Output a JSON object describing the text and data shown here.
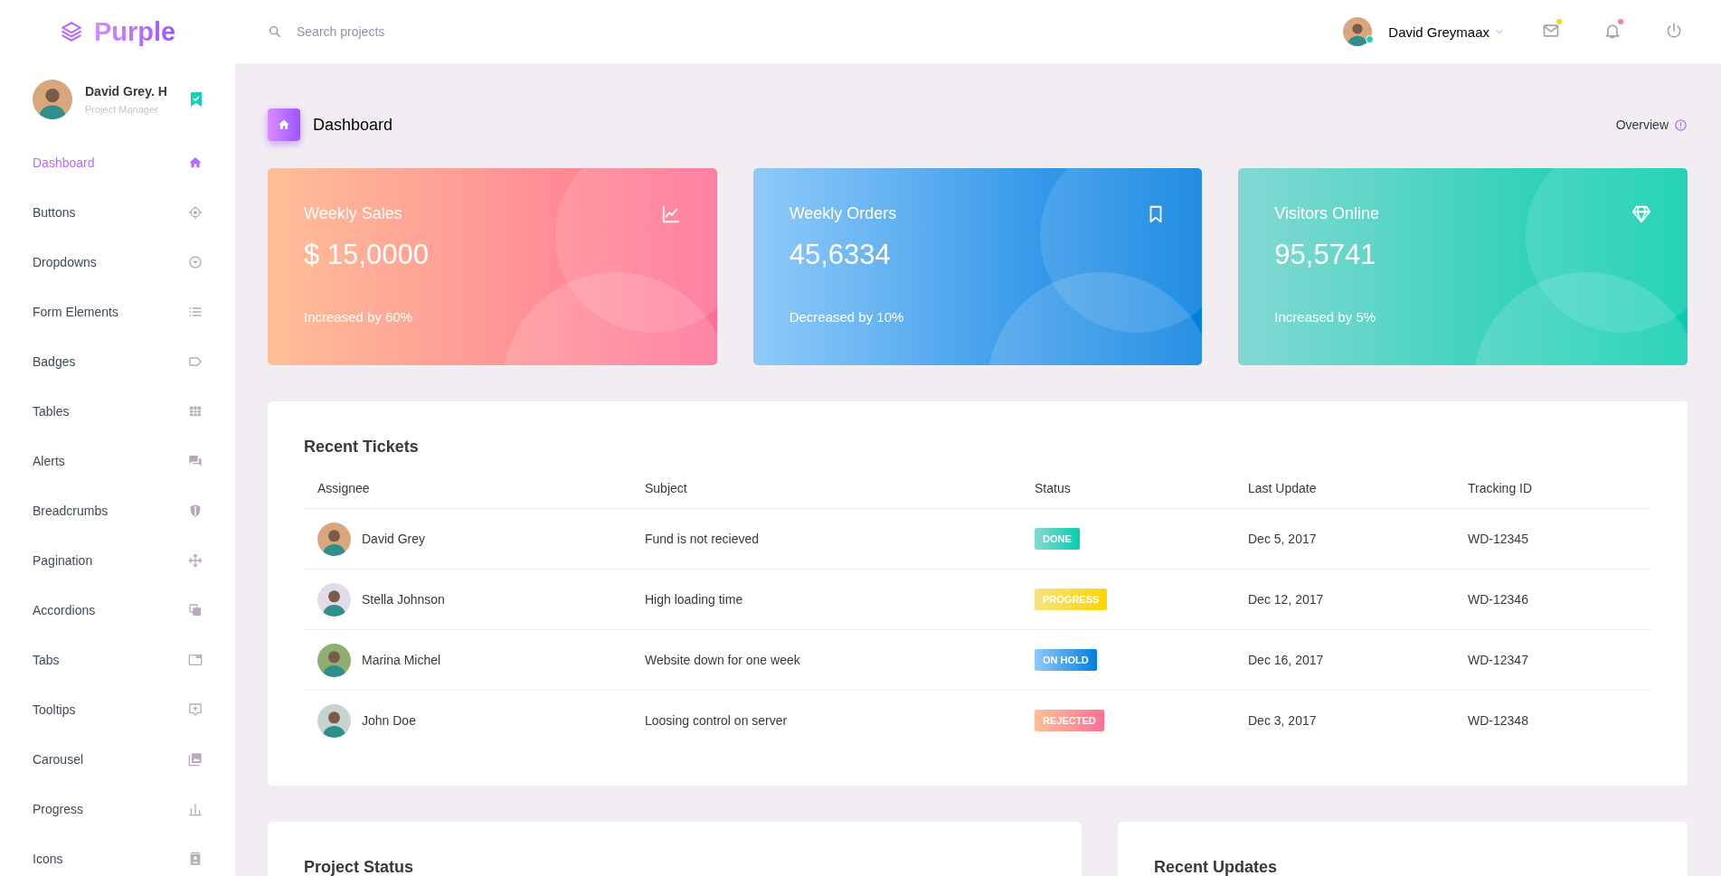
{
  "brand": {
    "name": "Purple"
  },
  "search": {
    "placeholder": "Search projects"
  },
  "user_menu": {
    "name": "David Greymaax",
    "online": true
  },
  "header_icons": [
    {
      "kind": "mail",
      "color": "#fed713"
    },
    {
      "kind": "bell",
      "color": "#fe7c96"
    },
    {
      "kind": "power"
    }
  ],
  "sidebar": {
    "profile": {
      "name": "David Grey. H",
      "role": "Project Manager",
      "verified": true
    },
    "items": [
      {
        "label": "Dashboard",
        "selected": true
      },
      {
        "label": "Buttons",
        "selected": false
      },
      {
        "label": "Dropdowns",
        "selected": false
      },
      {
        "label": "Form Elements",
        "selected": false
      },
      {
        "label": "Badges",
        "selected": false
      },
      {
        "label": "Tables",
        "selected": false
      },
      {
        "label": "Alerts",
        "selected": false
      },
      {
        "label": "Breadcrumbs",
        "selected": false
      },
      {
        "label": "Pagination",
        "selected": false
      },
      {
        "label": "Accordions",
        "selected": false
      },
      {
        "label": "Tabs",
        "selected": false
      },
      {
        "label": "Tooltips",
        "selected": false
      },
      {
        "label": "Carousel",
        "selected": false
      },
      {
        "label": "Progress",
        "selected": false
      },
      {
        "label": "Icons",
        "selected": false
      }
    ]
  },
  "page_header": {
    "title": "Dashboard",
    "link": "Overview"
  },
  "stat_cards": [
    {
      "title": "Weekly Sales",
      "value": "$ 15,0000",
      "note": "Increased by 60%"
    },
    {
      "title": "Weekly Orders",
      "value": "45,6334",
      "note": "Decreased by 10%"
    },
    {
      "title": "Visitors Online",
      "value": "95,5741",
      "note": "Increased by 5%"
    }
  ],
  "tickets": {
    "title": "Recent Tickets",
    "columns": [
      "Assignee",
      "Subject",
      "Status",
      "Last Update",
      "Tracking ID"
    ],
    "rows": [
      {
        "assignee": "David Grey",
        "subject": "Fund is not recieved",
        "status": {
          "label": "DONE",
          "kind": "done"
        },
        "updated": "Dec 5, 2017",
        "tracking_id": "WD-12345"
      },
      {
        "assignee": "Stella Johnson",
        "subject": "High loading time",
        "status": {
          "label": "PROGRESS",
          "kind": "progress"
        },
        "updated": "Dec 12, 2017",
        "tracking_id": "WD-12346"
      },
      {
        "assignee": "Marina Michel",
        "subject": "Website down for one week",
        "status": {
          "label": "ON HOLD",
          "kind": "hold"
        },
        "updated": "Dec 16, 2017",
        "tracking_id": "WD-12347"
      },
      {
        "assignee": "John Doe",
        "subject": "Loosing control on server",
        "status": {
          "label": "REJECTED",
          "kind": "rejected"
        },
        "updated": "Dec 3, 2017",
        "tracking_id": "WD-12348"
      }
    ]
  },
  "bottom_cards": [
    {
      "title": "Project Status"
    },
    {
      "title": "Recent Updates"
    }
  ]
}
